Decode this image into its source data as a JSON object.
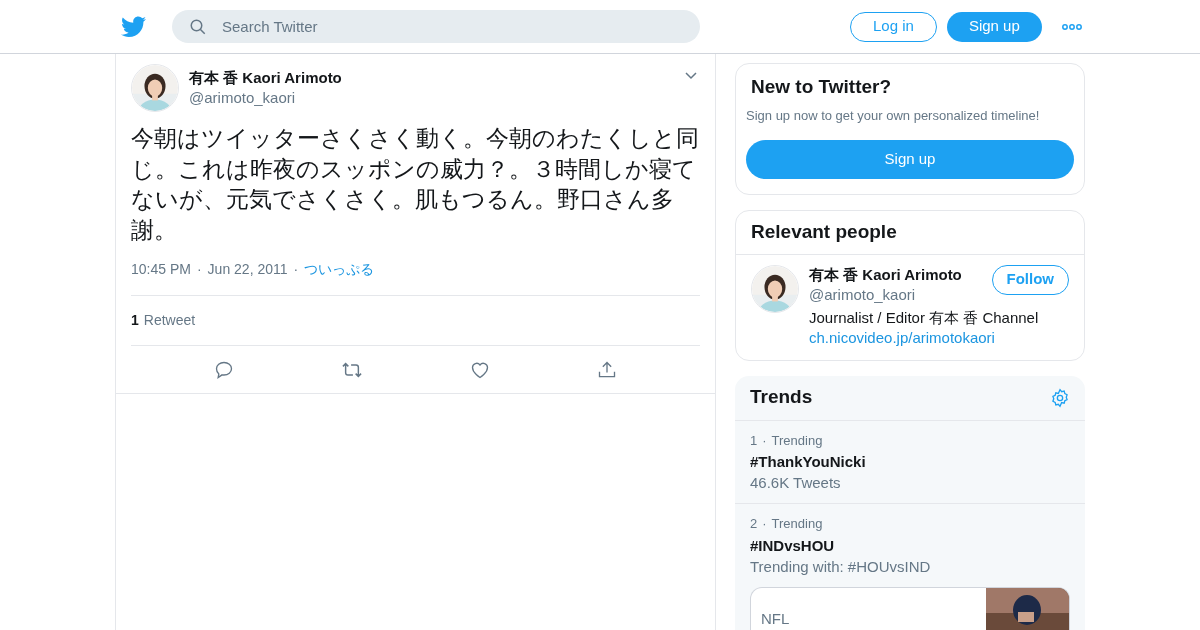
{
  "header": {
    "search_placeholder": "Search Twitter",
    "login": "Log in",
    "signup": "Sign up"
  },
  "tweet": {
    "name": "有本 香 Kaori Arimoto",
    "handle": "@arimoto_kaori",
    "text": "今朝はツイッターさくさく動く。今朝のわたくしと同じ。これは昨夜のスッポンの威力？。３時間しか寝てないが、元気でさくさく。肌もつるん。野口さん多謝。",
    "separator": "·",
    "time": "10:45 PM",
    "date": "Jun 22, 2011",
    "source": "ついっぷる",
    "retweet_count": "1",
    "retweet_label": "Retweet"
  },
  "signup_card": {
    "title": "New to Twitter?",
    "text": "Sign up now to get your own personalized timeline!",
    "button": "Sign up"
  },
  "relevant_people": {
    "title": "Relevant people",
    "people": [
      {
        "name": "有本 香 Kaori Arimoto",
        "handle": "@arimoto_kaori",
        "bio": "Journalist / Editor 有本 香 Channel",
        "link": "ch.nicovideo.jp/arimotokaori",
        "follow": "Follow"
      }
    ]
  },
  "trends": {
    "title": "Trends",
    "items": [
      {
        "rank": "1",
        "separator": "·",
        "label": "Trending",
        "name": "#ThankYouNicki",
        "meta": "46.6K Tweets"
      },
      {
        "rank": "2",
        "separator": "·",
        "label": "Trending",
        "name": "#INDvsHOU",
        "meta": "Trending with: #HOUvsIND",
        "card": {
          "label": "NFL",
          "kind": "picture"
        }
      }
    ]
  }
}
